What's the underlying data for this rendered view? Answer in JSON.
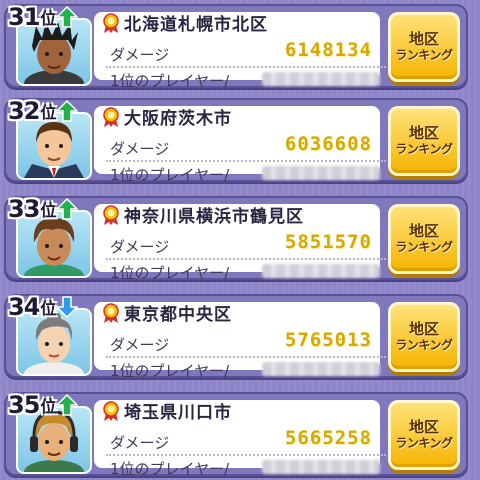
{
  "labels": {
    "damage": "ダメージ",
    "top_player": "1位のプレイヤー/",
    "region_button_line1": "地区",
    "region_button_line2": "ランキング",
    "rank_suffix": "位"
  },
  "entries": [
    {
      "rank": "31",
      "trend": "up",
      "region": "北海道札幌市北区",
      "damage": "6148134",
      "avatar": "avatar-dark-spiky-hair"
    },
    {
      "rank": "32",
      "trend": "up",
      "region": "大阪府茨木市",
      "damage": "6036608",
      "avatar": "avatar-man-suit"
    },
    {
      "rank": "33",
      "trend": "up",
      "region": "神奈川県横浜市鶴見区",
      "damage": "5851570",
      "avatar": "avatar-brown-hair-boy"
    },
    {
      "rank": "34",
      "trend": "down",
      "region": "東京都中央区",
      "damage": "5765013",
      "avatar": "avatar-gray-hair-woman"
    },
    {
      "rank": "35",
      "trend": "up",
      "region": "埼玉県川口市",
      "damage": "5665258",
      "avatar": "avatar-headphones-kid"
    }
  ],
  "colors": {
    "trend_up": "#22b14c",
    "trend_down": "#2c9be8",
    "damage_text": "#d6a800",
    "button_gold": "#f5b400"
  }
}
